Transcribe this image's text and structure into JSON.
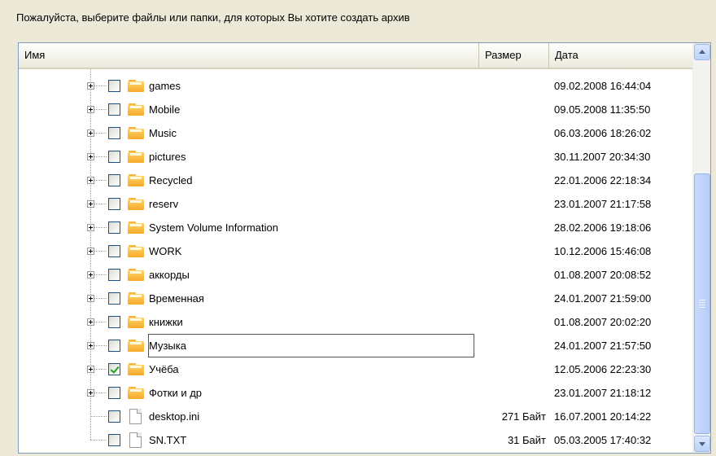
{
  "prompt": "Пожалуйста, выберите файлы или папки, для которых Вы хотите создать архив",
  "columns": {
    "name": "Имя",
    "size": "Размер",
    "date": "Дата"
  },
  "rows": [
    {
      "name": "games",
      "type": "folder",
      "checked": false,
      "size": "",
      "date": "09.02.2008 16:44:04"
    },
    {
      "name": "Mobile",
      "type": "folder",
      "checked": false,
      "size": "",
      "date": "09.05.2008 11:35:50"
    },
    {
      "name": "Music",
      "type": "folder",
      "checked": false,
      "size": "",
      "date": "06.03.2006 18:26:02"
    },
    {
      "name": "pictures",
      "type": "folder",
      "checked": false,
      "size": "",
      "date": "30.11.2007 20:34:30"
    },
    {
      "name": "Recycled",
      "type": "folder",
      "checked": false,
      "size": "",
      "date": "22.01.2006 22:18:34"
    },
    {
      "name": "reserv",
      "type": "folder",
      "checked": false,
      "size": "",
      "date": "23.01.2007 21:17:58"
    },
    {
      "name": "System Volume Information",
      "type": "folder",
      "checked": false,
      "size": "",
      "date": "28.02.2006 19:18:06"
    },
    {
      "name": "WORK",
      "type": "folder",
      "checked": false,
      "size": "",
      "date": "10.12.2006 15:46:08"
    },
    {
      "name": "аккорды",
      "type": "folder",
      "checked": false,
      "size": "",
      "date": "01.08.2007 20:08:52"
    },
    {
      "name": "Временная",
      "type": "folder",
      "checked": false,
      "size": "",
      "date": "24.01.2007 21:59:00"
    },
    {
      "name": "книжки",
      "type": "folder",
      "checked": false,
      "size": "",
      "date": "01.08.2007 20:02:20"
    },
    {
      "name": "Музыка",
      "type": "folder",
      "checked": false,
      "size": "",
      "date": "24.01.2007 21:57:50",
      "focused": true
    },
    {
      "name": "Учёба",
      "type": "folder",
      "checked": true,
      "size": "",
      "date": "12.05.2006 22:23:30"
    },
    {
      "name": "Фотки и др",
      "type": "folder",
      "checked": false,
      "size": "",
      "date": "23.01.2007 21:18:12"
    },
    {
      "name": "desktop.ini",
      "type": "file",
      "checked": false,
      "size": "271 Байт",
      "date": "16.07.2001 20:14:22"
    },
    {
      "name": "SN.TXT",
      "type": "file",
      "checked": false,
      "size": "31 Байт",
      "date": "05.03.2005 17:40:32"
    }
  ],
  "scrollbar": {
    "position": 0.4
  }
}
